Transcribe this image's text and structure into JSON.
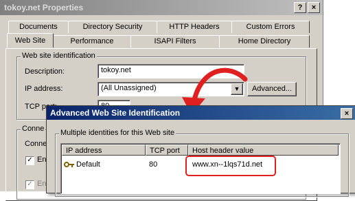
{
  "properties_window": {
    "title": "tokoy.net Properties",
    "caption_buttons": [
      "?",
      "×"
    ],
    "tabs_row1": [
      "Documents",
      "Directory Security",
      "HTTP Headers",
      "Custom Errors"
    ],
    "tabs_row2": [
      "Web Site",
      "Performance",
      "ISAPI Filters",
      "Home Directory"
    ],
    "active_tab": "Web Site",
    "identification_group": "Web site identification",
    "description_label": "Description:",
    "description_value": "tokoy.net",
    "ip_label": "IP address:",
    "ip_value": "(All Unassigned)",
    "advanced_button": "Advanced...",
    "tcp_label": "TCP port:",
    "tcp_value": "80",
    "connections_group": "Conne",
    "connections_label": "Conne",
    "checkbox_label": "En",
    "checkbox_label2": "En"
  },
  "advanced_dialog": {
    "title": "Advanced Web Site Identification",
    "close_icon": "close-icon",
    "group_label": "Multiple identities for this Web site",
    "columns": [
      "IP address",
      "TCP port",
      "Host header value"
    ],
    "rows": [
      {
        "icon": "key-icon",
        "ip": "Default",
        "port": "80",
        "host": "www.xn--1lqs71d.net"
      }
    ]
  },
  "colors": {
    "highlight": "#e02020",
    "active_title": "#0a246a",
    "inactive_title": "#808080"
  }
}
